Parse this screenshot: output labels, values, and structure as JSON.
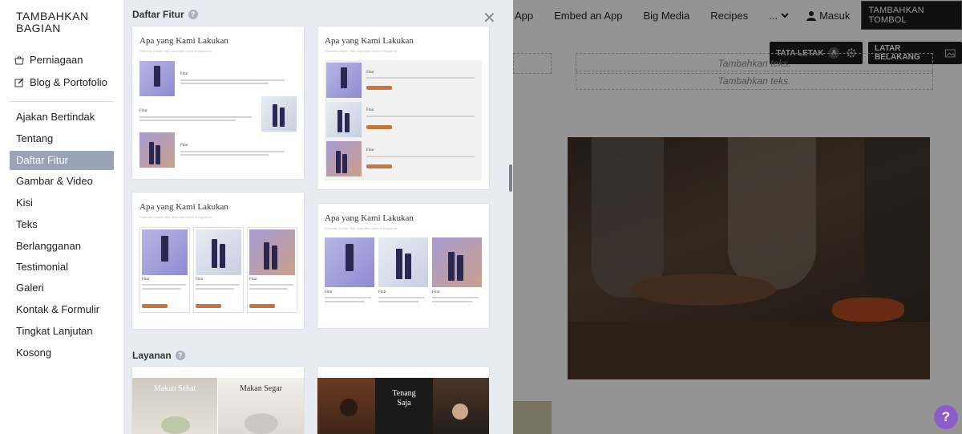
{
  "sidebar": {
    "title": "TAMBAHKAN BAGIAN",
    "top_items": [
      {
        "label": "Perniagaan",
        "icon": "shop-icon"
      },
      {
        "label": "Blog & Portofolio",
        "icon": "edit-icon"
      }
    ],
    "categories": [
      {
        "label": "Ajakan Bertindak",
        "active": false
      },
      {
        "label": "Tentang",
        "active": false
      },
      {
        "label": "Daftar Fitur",
        "active": true
      },
      {
        "label": "Gambar & Video",
        "active": false
      },
      {
        "label": "Kisi",
        "active": false
      },
      {
        "label": "Teks",
        "active": false
      },
      {
        "label": "Berlangganan",
        "active": false
      },
      {
        "label": "Testimonial",
        "active": false
      },
      {
        "label": "Galeri",
        "active": false
      },
      {
        "label": "Kontak & Formulir",
        "active": false
      },
      {
        "label": "Tingkat Lanjutan",
        "active": false
      },
      {
        "label": "Kosong",
        "active": false
      }
    ]
  },
  "panel": {
    "section_features": "Daftar Fitur",
    "section_services": "Layanan",
    "help_glyph": "?",
    "close_glyph": "✕",
    "card_heading": "Apa yang Kami Lakukan",
    "card_sub": "Pameran proyek, fitur, atau klien Anda di bagian ini.",
    "feature_label": "Fitur",
    "service_cards": [
      {
        "left_label": "Makan Sehat",
        "right_label": "Makan Segar"
      },
      {
        "title_line1": "Tenang",
        "title_line2": "Saja"
      }
    ]
  },
  "background": {
    "nav": [
      "App",
      "Embed an App",
      "Big Media",
      "Recipes"
    ],
    "more_label": "...",
    "login_label": "Masuk",
    "add_button": "TAMBAHKAN TOMBOL",
    "layout_button": "TATA LETAK",
    "layout_badge": "A",
    "bg_button": "LATAR BELAKANG",
    "placeholder_text": "Tambahkan teks.",
    "placeholder_text_partial": "Tambahkan teks."
  },
  "help_fab": "?",
  "colors": {
    "active_category": "#9aa3b8",
    "panel_bg": "#e8ebf1",
    "accent_button": "#c8743f",
    "fab": "#8a5dc8"
  }
}
